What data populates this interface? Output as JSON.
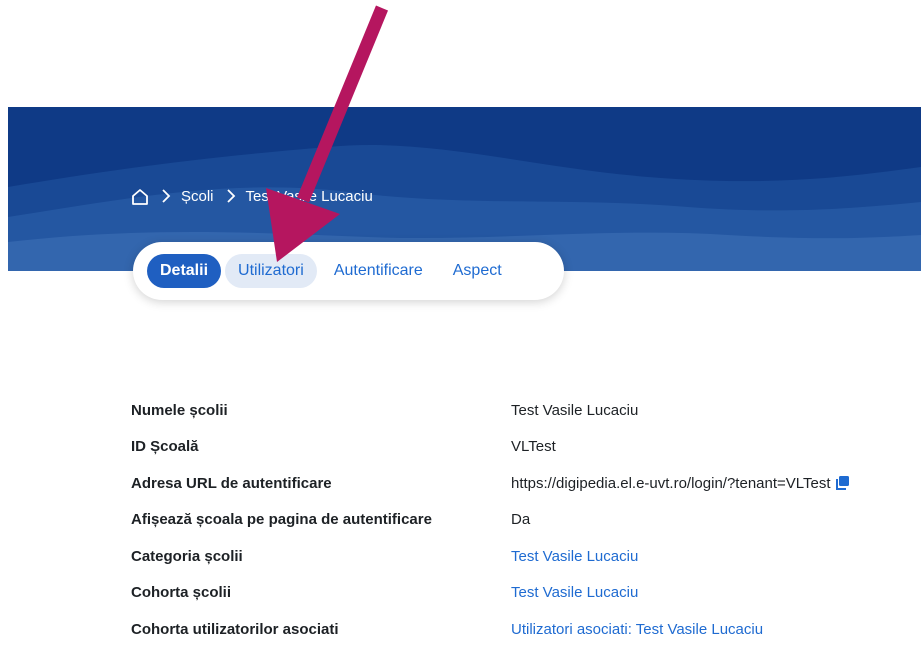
{
  "breadcrumb": {
    "home_icon": "home-icon",
    "items": [
      "Școli",
      "Test Vasile Lucaciu"
    ]
  },
  "tabs": [
    {
      "label": "Detalii",
      "state": "active"
    },
    {
      "label": "Utilizatori",
      "state": "hover"
    },
    {
      "label": "Autentificare",
      "state": "normal"
    },
    {
      "label": "Aspect",
      "state": "normal"
    }
  ],
  "details": [
    {
      "label": "Numele școlii",
      "value": "Test Vasile Lucaciu"
    },
    {
      "label": "ID Școală",
      "value": "VLTest"
    },
    {
      "label": "Adresa URL de autentificare",
      "value": "https://digipedia.el.e-uvt.ro/login/?tenant=VLTest",
      "icon": "copy-icon"
    },
    {
      "label": "Afișează școala pe pagina de autentificare",
      "value": "Da"
    },
    {
      "label": "Categoria școlii",
      "value": "Test Vasile Lucaciu",
      "link": true
    },
    {
      "label": "Cohorta școlii",
      "value": "Test Vasile Lucaciu",
      "link": true
    },
    {
      "label": "Cohorta utilizatorilor asociati",
      "value": "Utilizatori asociati: Test Vasile Lucaciu",
      "link": true
    }
  ],
  "colors": {
    "hero": "#0f3a86",
    "accent": "#1f5fc1",
    "link": "#1f6bd1",
    "annotation_arrow": "#b5165f"
  }
}
